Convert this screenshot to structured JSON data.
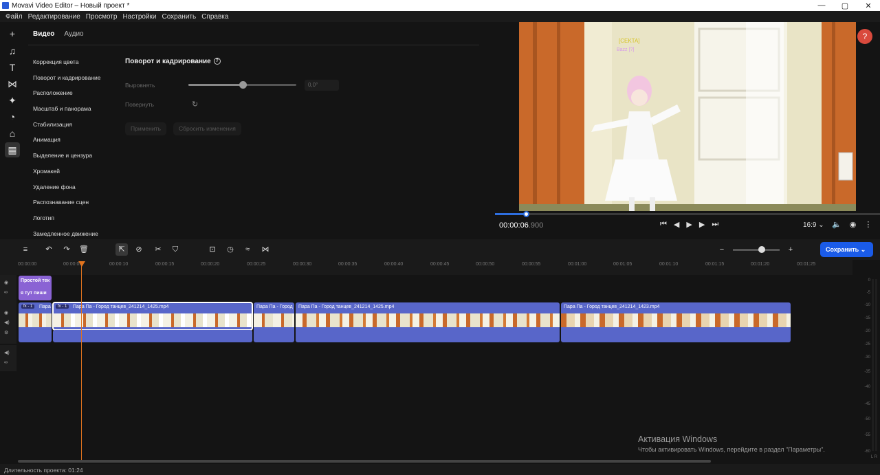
{
  "window": {
    "title": "Movavi Video Editor – Новый проект *",
    "controls": [
      "—",
      "▢",
      "✕"
    ]
  },
  "menu": [
    "Файл",
    "Редактирование",
    "Просмотр",
    "Настройки",
    "Сохранить",
    "Справка"
  ],
  "panel": {
    "tabs": [
      "Видео",
      "Аудио"
    ],
    "items": [
      "Коррекция цвета",
      "Поворот и кадрирование",
      "Расположение",
      "Масштаб и панорама",
      "Стабилизация",
      "Анимация",
      "Выделение и цензура",
      "Хромакей",
      "Удаление фона",
      "Распознавание сцен",
      "Логотип",
      "Замедленное движение"
    ],
    "section_title": "Поворот и кадрирование",
    "align_label": "Выровнять",
    "align_value": "0,0°",
    "align_fraction": 0.5,
    "rotate_label": "Повернуть",
    "apply_label": "Применить",
    "reset_label": "Сбросить изменения"
  },
  "preview": {
    "timecode_main": "00:00:06",
    "timecode_ms": ".900",
    "progress_fraction": 0.08,
    "aspect": "16:9",
    "help": "?",
    "subtitle_line1": "[CEKTA]",
    "subtitle_line2": "Bazz [?]"
  },
  "timeline": {
    "save_button": "Сохранить",
    "ruler": [
      "00:00:00",
      "00:00:05",
      "00:00:10",
      "00:00:15",
      "00:00:20",
      "00:00:25",
      "00:00:30",
      "00:00:35",
      "00:00:40",
      "00:00:45",
      "00:00:50",
      "00:00:55",
      "00:01:00",
      "00:01:05",
      "00:01:10",
      "00:01:15",
      "00:01:20",
      "00:01:25"
    ],
    "title_clip_1": "Простой тек",
    "title_clip_2": "я тут пиши",
    "fx_label": "fx - 1",
    "clip_short": "Пара",
    "clip_a": "Пара Па - Город танцев_241214_1425.mp4",
    "clip_b": "Пара Па - Город",
    "clip_c": "Пара Па - Город танцев_241214_1425.mp4",
    "clip_d": "Пара Па - Город танцев_241214_1423.mp4",
    "meter_labels": [
      "0",
      "-5",
      "-10",
      "-15",
      "-20",
      "-25",
      "-30",
      "-35",
      "-40",
      "-45",
      "-50",
      "-55",
      "-60"
    ],
    "meter_lr": "L R"
  },
  "status": {
    "duration": "Длительность проекта: 01:24"
  },
  "watermark": {
    "line1": "Активация Windows",
    "line2": "Чтобы активировать Windows, перейдите в раздел \"Параметры\"."
  },
  "colors": {
    "accent": "#1a5be8",
    "clip": "#5866c9",
    "title_clip": "#8a63d4",
    "playhead": "#e0731e",
    "help": "#d94a3d"
  }
}
